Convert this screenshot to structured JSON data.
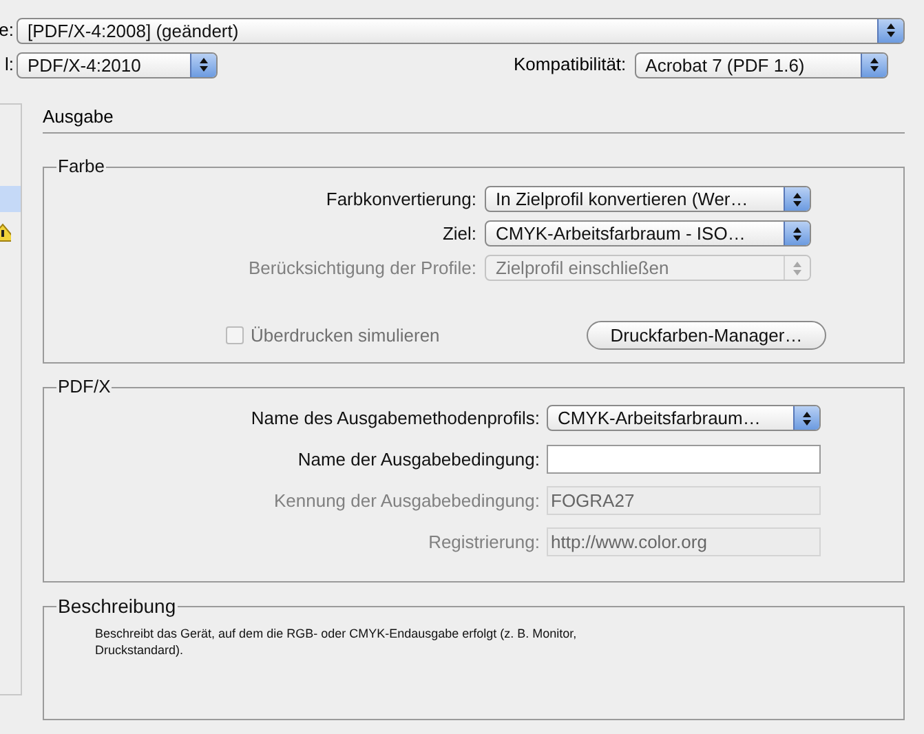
{
  "top": {
    "preset": {
      "label": "e:",
      "value": "[PDF/X-4:2008] (geändert)"
    },
    "standard": {
      "label": "l:",
      "value": "PDF/X-4:2010"
    },
    "compat": {
      "label": "Kompatibilität:",
      "value": "Acrobat 7 (PDF 1.6)"
    }
  },
  "sidebar": {
    "items": [
      {
        "selected": true
      }
    ]
  },
  "section_title": "Ausgabe",
  "farbe": {
    "title": "Farbe",
    "rows": [
      {
        "label": "Farbkonvertierung:",
        "value": "In Zielprofil konvertieren (Wer…",
        "disabled": false
      },
      {
        "label": "Ziel:",
        "value": "CMYK-Arbeitsfarbraum - ISO…",
        "disabled": false
      },
      {
        "label": "Berücksichtigung der Profile:",
        "value": "Zielprofil einschließen",
        "disabled": true
      }
    ],
    "checkbox": {
      "label": "Überdrucken simulieren",
      "checked": false,
      "disabled": true
    },
    "button": "Druckfarben-Manager…"
  },
  "pdfx": {
    "title": "PDF/X",
    "rows": [
      {
        "kind": "select",
        "label": "Name des Ausgabemethodenprofils:",
        "value": "CMYK-Arbeitsfarbraum…",
        "disabled": false
      },
      {
        "kind": "text",
        "label": "Name der Ausgabebedingung:",
        "disabled": false
      },
      {
        "kind": "text",
        "label": "Kennung der Ausgabebedingung:",
        "value": "FOGRA27",
        "disabled": true
      },
      {
        "kind": "text",
        "label": "Registrierung:",
        "value": "http://www.color.org",
        "disabled": true
      }
    ]
  },
  "beschreibung": {
    "title": "Beschreibung",
    "text": "Beschreibt das Gerät, auf dem die RGB- oder CMYK-Endausgabe erfolgt (z. B. Monitor, Druckstandard)."
  }
}
